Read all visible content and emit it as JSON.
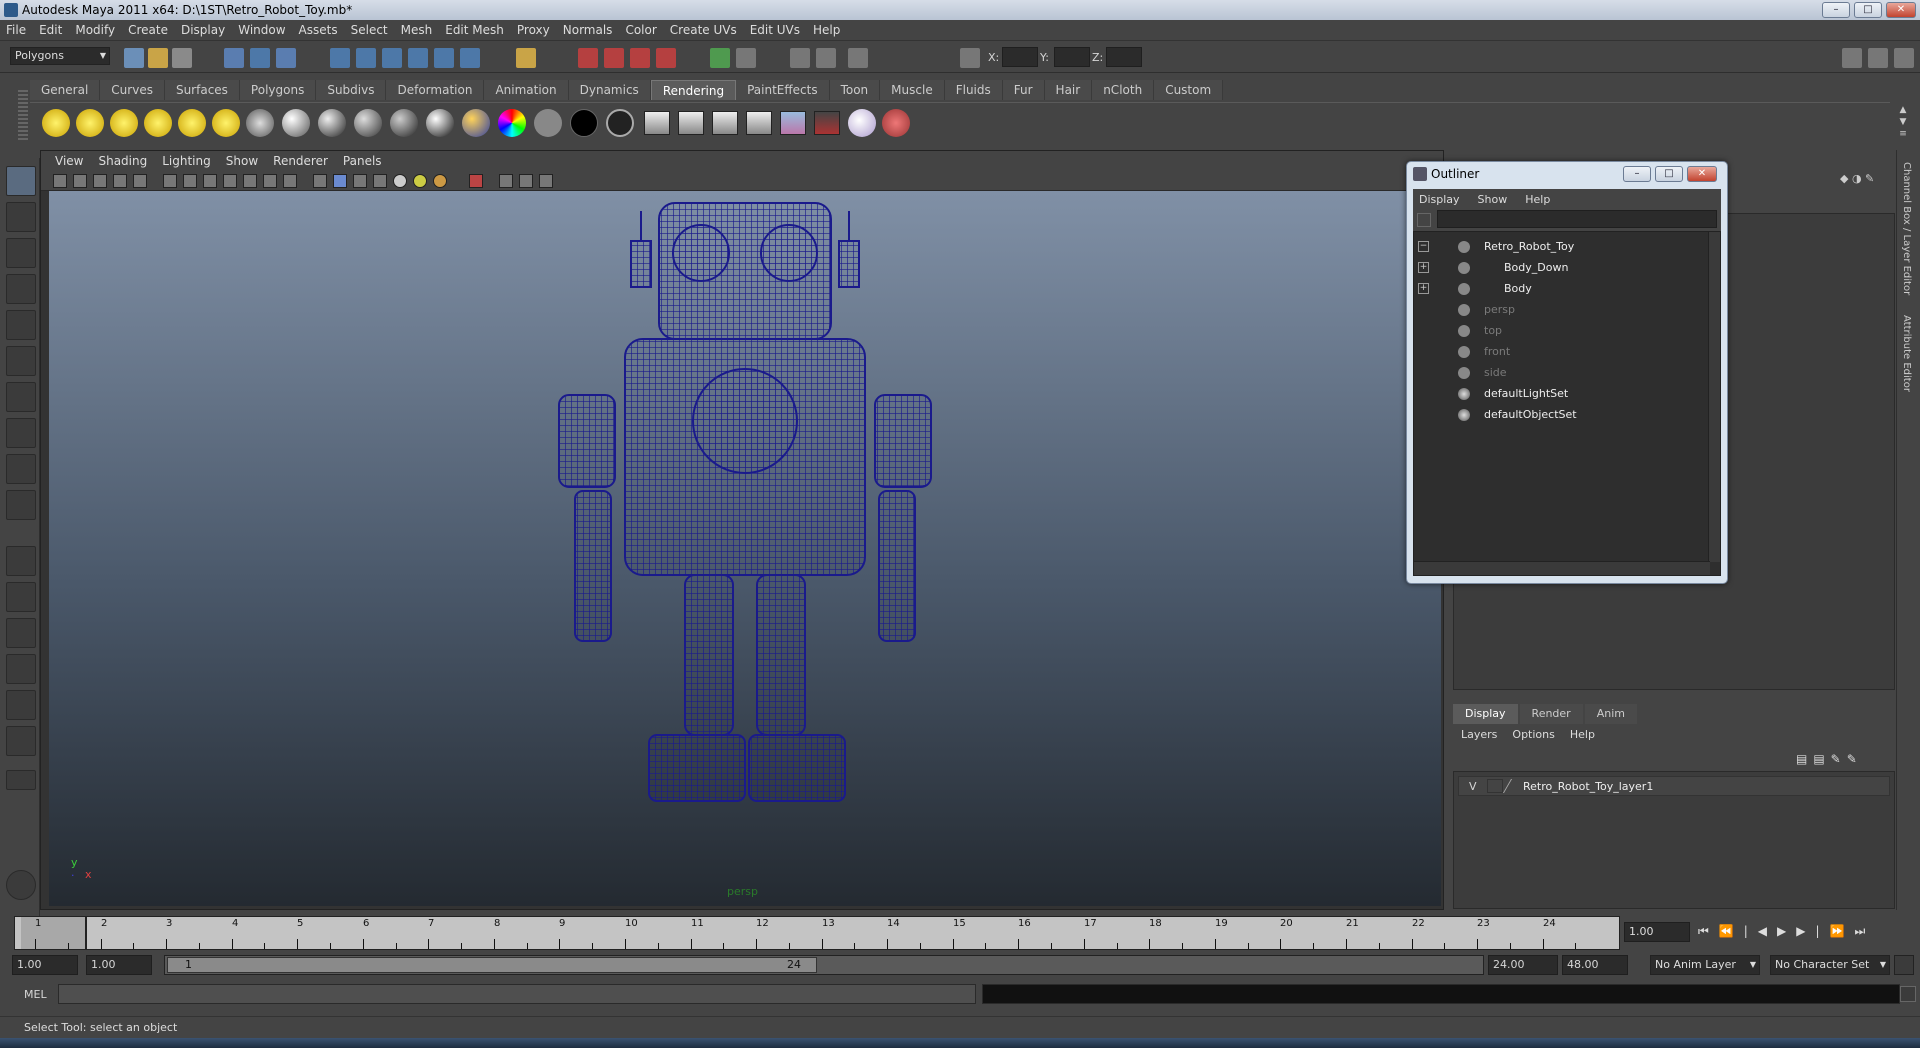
{
  "window": {
    "title": "Autodesk Maya 2011 x64: D:\\1ST\\Retro_Robot_Toy.mb*",
    "minimize_icon": "minimize-icon",
    "maximize_icon": "maximize-icon",
    "close_icon": "close-icon"
  },
  "menubar": [
    "File",
    "Edit",
    "Modify",
    "Create",
    "Display",
    "Window",
    "Assets",
    "Select",
    "Mesh",
    "Edit Mesh",
    "Proxy",
    "Normals",
    "Color",
    "Create UVs",
    "Edit UVs",
    "Help"
  ],
  "statusline": {
    "menuset": "Polygons",
    "x_label": "X:",
    "y_label": "Y:",
    "z_label": "Z:"
  },
  "shelf": {
    "tabs": [
      "General",
      "Curves",
      "Surfaces",
      "Polygons",
      "Subdivs",
      "Deformation",
      "Animation",
      "Dynamics",
      "Rendering",
      "PaintEffects",
      "Toon",
      "Muscle",
      "Fluids",
      "Fur",
      "Hair",
      "nCloth",
      "Custom"
    ],
    "active": "Rendering"
  },
  "viewport": {
    "menu": [
      "View",
      "Shading",
      "Lighting",
      "Show",
      "Renderer",
      "Panels"
    ],
    "camera_label": "persp",
    "axis_y": "y",
    "axis_x": "x",
    "wire_color": "#1a1a8c"
  },
  "outliner": {
    "title": "Outliner",
    "menu": [
      "Display",
      "Show",
      "Help"
    ],
    "items": [
      {
        "label": "Retro_Robot_Toy",
        "state": "lit",
        "expander": "−"
      },
      {
        "label": "Body_Down",
        "state": "lit",
        "expander": "+"
      },
      {
        "label": "Body",
        "state": "lit",
        "expander": "+"
      },
      {
        "label": "persp",
        "state": "dim",
        "expander": ""
      },
      {
        "label": "top",
        "state": "dim",
        "expander": ""
      },
      {
        "label": "front",
        "state": "dim",
        "expander": ""
      },
      {
        "label": "side",
        "state": "dim",
        "expander": ""
      },
      {
        "label": "defaultLightSet",
        "state": "lit",
        "expander": ""
      },
      {
        "label": "defaultObjectSet",
        "state": "lit",
        "expander": ""
      }
    ]
  },
  "layers": {
    "tabs": [
      "Display",
      "Render",
      "Anim"
    ],
    "active": "Display",
    "menu": [
      "Layers",
      "Options",
      "Help"
    ],
    "row": {
      "visibility": "V",
      "name": "Retro_Robot_Toy_layer1"
    }
  },
  "sidetabs": [
    "Channel Box / Layer Editor",
    "Attribute Editor"
  ],
  "timeline": {
    "ticks": [
      "1",
      "2",
      "3",
      "4",
      "5",
      "6",
      "7",
      "8",
      "9",
      "10",
      "11",
      "12",
      "13",
      "14",
      "15",
      "16",
      "17",
      "18",
      "19",
      "20",
      "21",
      "22",
      "23",
      "24"
    ],
    "current_frame": "1.00"
  },
  "range": {
    "start_outer": "1.00",
    "start_inner": "1.00",
    "slider_start": "1",
    "slider_end": "24",
    "end_inner": "24.00",
    "end_outer": "48.00",
    "anim_layer": "No Anim Layer",
    "char_set": "No Character Set"
  },
  "cmdline": {
    "label": "MEL"
  },
  "help": "Select Tool: select an object"
}
